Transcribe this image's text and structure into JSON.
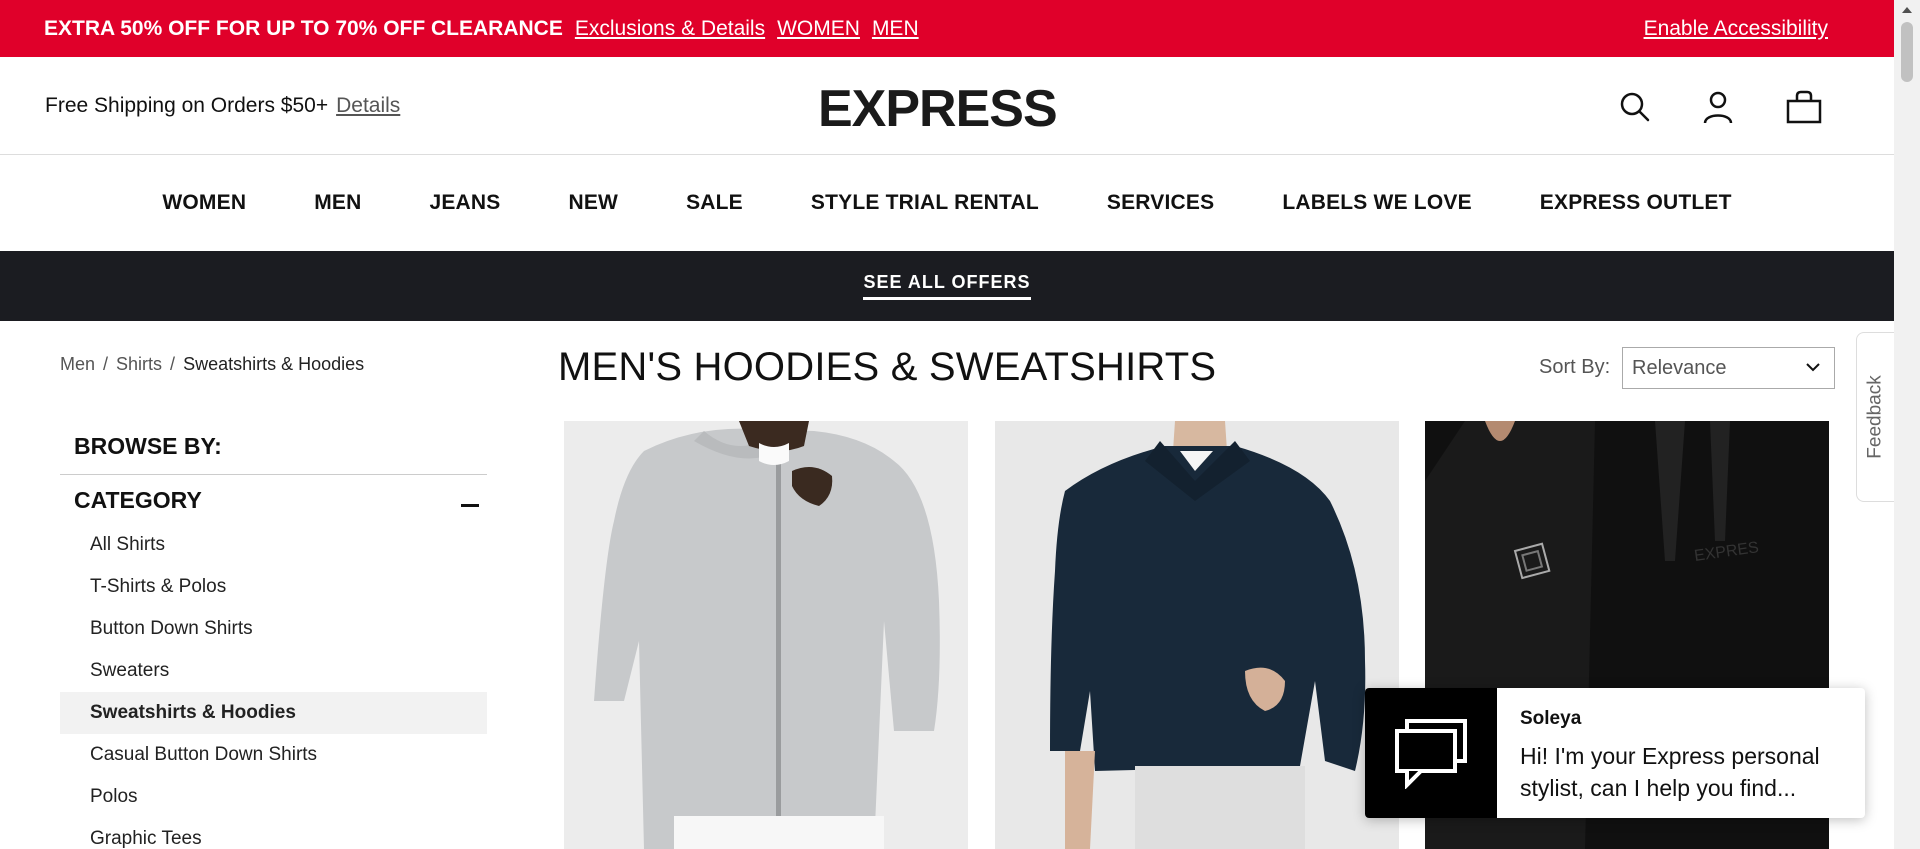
{
  "promo": {
    "headline": "EXTRA 50% OFF FOR UP TO 70% OFF CLEARANCE",
    "details_link": "Exclusions & Details",
    "women_link": "WOMEN",
    "men_link": "MEN",
    "accessibility_link": "Enable Accessibility",
    "bg_color": "#e0002a"
  },
  "header": {
    "shipping_text": "Free Shipping on Orders $50+",
    "shipping_details": "Details",
    "logo": "EXPRESS",
    "icons": [
      "search-icon",
      "account-icon",
      "shopping-bag-icon"
    ]
  },
  "nav": {
    "items": [
      "WOMEN",
      "MEN",
      "JEANS",
      "NEW",
      "SALE",
      "STYLE TRIAL RENTAL",
      "SERVICES",
      "LABELS WE LOVE",
      "EXPRESS OUTLET"
    ]
  },
  "offers": {
    "label": "SEE ALL OFFERS"
  },
  "breadcrumb": {
    "items": [
      "Men",
      "Shirts",
      "Sweatshirts & Hoodies"
    ],
    "separator": "/"
  },
  "sidebar": {
    "browse_heading": "BROWSE BY:",
    "category_heading": "CATEGORY",
    "categories": [
      "All Shirts",
      "T-Shirts & Polos",
      "Button Down Shirts",
      "Sweaters",
      "Sweatshirts & Hoodies",
      "Casual Button Down Shirts",
      "Polos",
      "Graphic Tees"
    ],
    "active_category": "Sweatshirts & Hoodies"
  },
  "main": {
    "title": "MEN'S HOODIES & SWEATSHIRTS",
    "sort_label": "Sort By:",
    "sort_value": "Relevance"
  },
  "products": [
    {
      "image": "grey-zip-bomber-sweatshirt"
    },
    {
      "image": "navy-shawl-collar-pullover"
    },
    {
      "image": "black-logo-hoodie"
    }
  ],
  "feedback": {
    "label": "Feedback"
  },
  "chat": {
    "name": "Soleya",
    "message": "Hi! I'm your Express personal stylist, can I help you find..."
  }
}
